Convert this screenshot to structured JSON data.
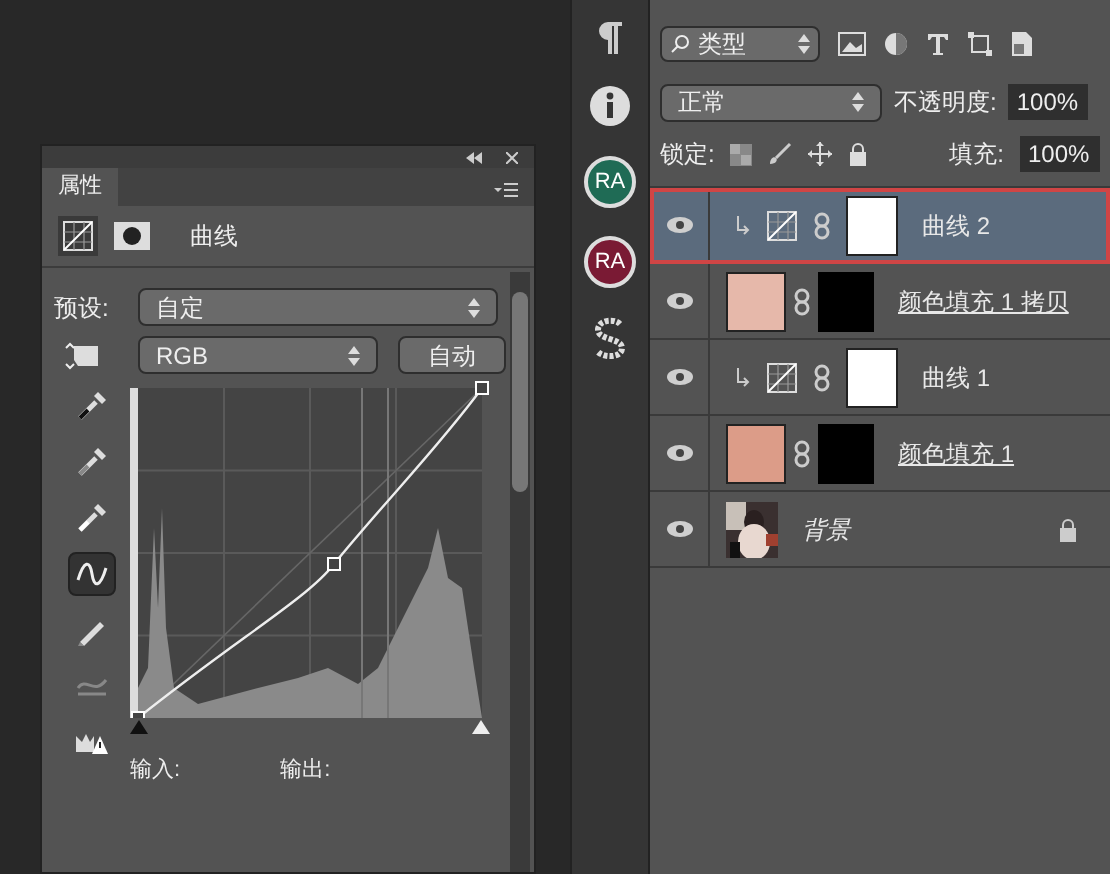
{
  "properties": {
    "tab": "属性",
    "title": "曲线",
    "preset_label": "预设:",
    "preset": "自定",
    "channel": "RGB",
    "auto_button": "自动",
    "input_label": "输入:",
    "output_label": "输出:",
    "tools": [
      {
        "kind": "eyedropper-black",
        "selected": false
      },
      {
        "kind": "eyedropper-gray",
        "selected": false
      },
      {
        "kind": "eyedropper-white",
        "selected": false
      },
      {
        "kind": "curve",
        "selected": true
      },
      {
        "kind": "pencil",
        "selected": false
      },
      {
        "kind": "smooth",
        "selected": false
      },
      {
        "kind": "clip-warning",
        "selected": false
      }
    ]
  },
  "side_strip": {
    "badges": [
      {
        "text": "RA",
        "color": "#1f6b55"
      },
      {
        "text": "RA",
        "color": "#7a1a34"
      }
    ]
  },
  "layers": {
    "filter": "类型",
    "blend_mode": "正常",
    "opacity_label": "不透明度:",
    "opacity": "100%",
    "lock_label": "锁定:",
    "fill_label": "填充:",
    "fill": "100%",
    "items": [
      {
        "kind": "adjustment",
        "name": "曲线 2",
        "selected": true,
        "visible": true,
        "clipped": true
      },
      {
        "kind": "fill",
        "name": "颜色填充 1 拷贝",
        "selected": false,
        "visible": true,
        "color": "#e6b8aa"
      },
      {
        "kind": "adjustment",
        "name": "曲线 1",
        "selected": false,
        "visible": true,
        "clipped": true
      },
      {
        "kind": "fill",
        "name": "颜色填充 1",
        "selected": false,
        "visible": true,
        "color": "#dc9c88"
      },
      {
        "kind": "background",
        "name": "背景",
        "selected": false,
        "visible": true
      }
    ]
  }
}
